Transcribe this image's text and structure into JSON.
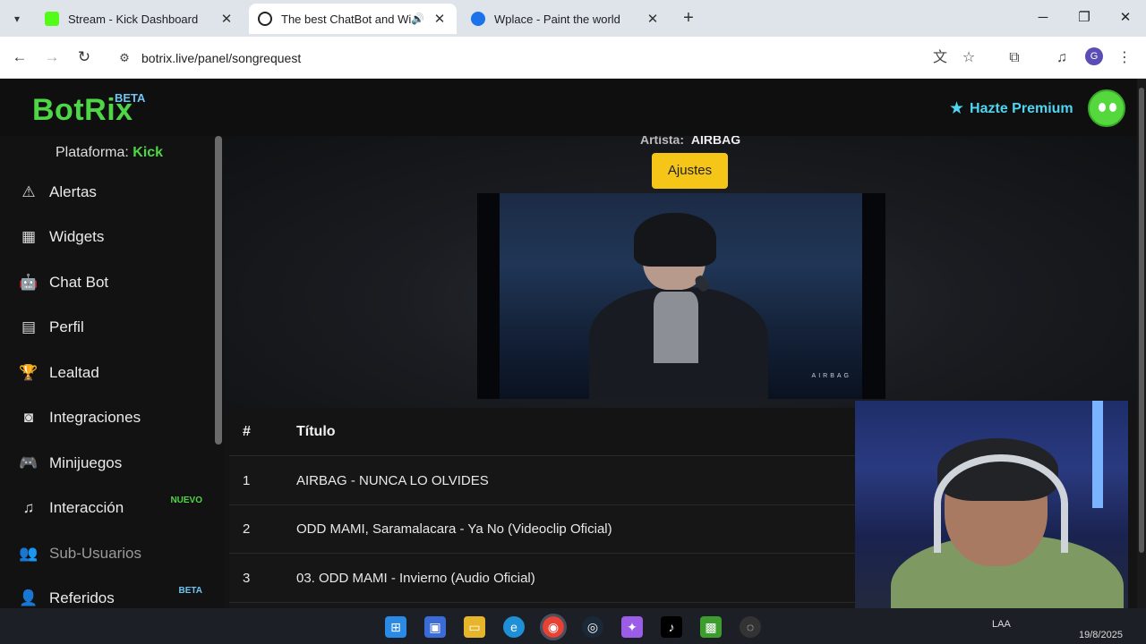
{
  "browser": {
    "tabs": [
      {
        "title": "Stream - Kick Dashboard",
        "favicon_color": "#53fc18"
      },
      {
        "title": "The best ChatBot and Widg",
        "favicon_color": "#222222"
      },
      {
        "title": "Wplace - Paint the world",
        "favicon_color": "#1a73e8"
      }
    ],
    "url": "botrix.live/panel/songrequest",
    "profile_initial": "G"
  },
  "app": {
    "logo": "BotRix",
    "logo_badge": "BETA",
    "premium_label": "Hazte Premium"
  },
  "sidebar": {
    "platform_label": "Plataforma:",
    "platform_value": "Kick",
    "items": [
      {
        "label": "Alertas",
        "icon": "warning-icon"
      },
      {
        "label": "Widgets",
        "icon": "grid-icon"
      },
      {
        "label": "Chat Bot",
        "icon": "robot-icon"
      },
      {
        "label": "Perfil",
        "icon": "id-card-icon"
      },
      {
        "label": "Lealtad",
        "icon": "trophy-icon"
      },
      {
        "label": "Integraciones",
        "icon": "discord-icon"
      },
      {
        "label": "Minijuegos",
        "icon": "gamepad-icon"
      },
      {
        "label": "Interacción",
        "icon": "music-icon",
        "badge": "NUEVO"
      },
      {
        "label": "Sub-Usuarios",
        "icon": "users-icon"
      },
      {
        "label": "Referidos",
        "icon": "user-group-icon",
        "badge": "BETA"
      }
    ]
  },
  "player": {
    "artist_label": "Artista:",
    "artist_value": "AIRBAG",
    "settings_button": "Ajustes",
    "watermark": "AIRBAG"
  },
  "queue": {
    "headers": {
      "num": "#",
      "title": "Título"
    },
    "rows": [
      {
        "num": "1",
        "title": "AIRBAG - NUNCA LO OLVIDES"
      },
      {
        "num": "2",
        "title": "ODD MAMI, Saramalacara - Ya No (Videoclip Oficial)"
      },
      {
        "num": "3",
        "title": "03. ODD MAMI - Invierno (Audio Oficial)"
      }
    ]
  },
  "taskbar": {
    "lang": "LAA",
    "date": "19/8/2025"
  }
}
